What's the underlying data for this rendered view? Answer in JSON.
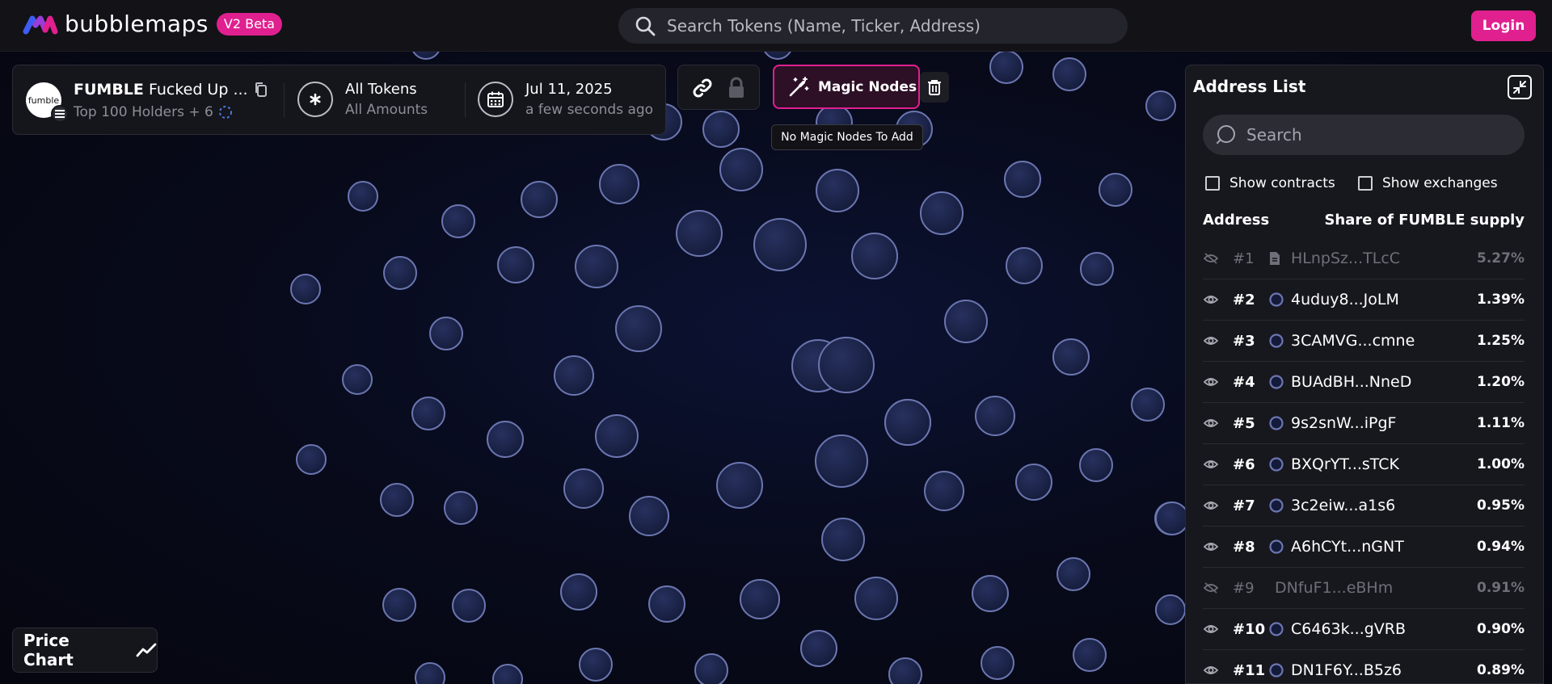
{
  "header": {
    "logo_text": "bubblemaps",
    "badge": "V2 Beta",
    "search_placeholder": "Search Tokens (Name, Ticker, Address)",
    "login_label": "Login"
  },
  "token": {
    "avatar_text": "fumble",
    "symbol": "FUMBLE",
    "name": "Fucked Up ...",
    "holders": "Top 100 Holders + 6"
  },
  "filter": {
    "title": "All Tokens",
    "subtitle": "All Amounts"
  },
  "snapshot": {
    "date": "Jul 11, 2025",
    "relative": "a few seconds ago"
  },
  "magic": {
    "label": "Magic Nodes",
    "tooltip": "No Magic Nodes To Add"
  },
  "price_chart": {
    "label": "Price Chart"
  },
  "address_list": {
    "title": "Address List",
    "search_placeholder": "Search",
    "show_contracts": "Show contracts",
    "show_exchanges": "Show exchanges",
    "col_address": "Address",
    "col_share": "Share of FUMBLE supply",
    "rows": [
      {
        "rank": "#1",
        "address": "HLnpSz...TLcC",
        "share": "5.27%",
        "hidden": true,
        "type": "contract"
      },
      {
        "rank": "#2",
        "address": "4uduy8...JoLM",
        "share": "1.39%",
        "hidden": false,
        "type": "wallet"
      },
      {
        "rank": "#3",
        "address": "3CAMVG...cmne",
        "share": "1.25%",
        "hidden": false,
        "type": "wallet"
      },
      {
        "rank": "#4",
        "address": "BUAdBH...NneD",
        "share": "1.20%",
        "hidden": false,
        "type": "wallet"
      },
      {
        "rank": "#5",
        "address": "9s2snW...iPgF",
        "share": "1.11%",
        "hidden": false,
        "type": "wallet"
      },
      {
        "rank": "#6",
        "address": "BXQrYT...sTCK",
        "share": "1.00%",
        "hidden": false,
        "type": "wallet"
      },
      {
        "rank": "#7",
        "address": "3c2eiw...a1s6",
        "share": "0.95%",
        "hidden": false,
        "type": "wallet"
      },
      {
        "rank": "#8",
        "address": "A6hCYt...nGNT",
        "share": "0.94%",
        "hidden": false,
        "type": "wallet"
      },
      {
        "rank": "#9",
        "address": "DNfuF1...eBHm",
        "share": "0.91%",
        "hidden": true,
        "type": "none"
      },
      {
        "rank": "#10",
        "address": "C6463k...gVRB",
        "share": "0.90%",
        "hidden": false,
        "type": "wallet"
      },
      {
        "rank": "#11",
        "address": "DN1F6Y...B5z6",
        "share": "0.89%",
        "hidden": false,
        "type": "wallet"
      }
    ]
  },
  "colors": {
    "accent": "#e0208f",
    "bubble_fill": "#1b2448",
    "bubble_stroke": "#6b76b0"
  }
}
